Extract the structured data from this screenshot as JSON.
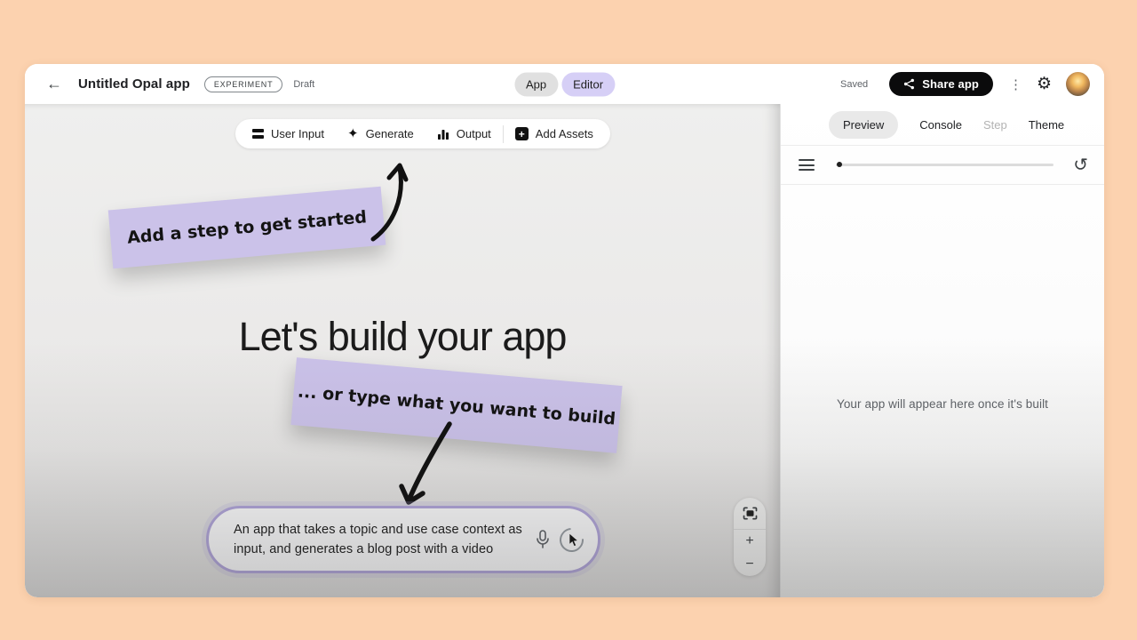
{
  "header": {
    "title": "Untitled Opal app",
    "badge": "EXPERIMENT",
    "status": "Draft",
    "mode": {
      "app": "App",
      "editor": "Editor"
    },
    "saved": "Saved",
    "share": "Share app"
  },
  "canvas": {
    "toolbar": {
      "user_input": "User Input",
      "generate": "Generate",
      "output": "Output",
      "add_assets": "Add Assets"
    },
    "sticky_top": "Add a step to get started",
    "heading": "Let's build your app",
    "sticky_bottom": "... or type what you want to build",
    "prompt": "An app that takes a topic and use case context as input, and generates a blog post with a video",
    "zoom": {
      "in": "+",
      "out": "−"
    }
  },
  "preview": {
    "tabs": [
      {
        "label": "Preview",
        "active": true
      },
      {
        "label": "Console"
      },
      {
        "label": "Step",
        "disabled": true
      },
      {
        "label": "Theme"
      }
    ],
    "message": "Your app will appear here once it's built"
  },
  "icons": {
    "back": "←",
    "more": "⋮",
    "settings": "⚙",
    "refresh": "↺",
    "sparkle": "✦",
    "plus": "+"
  },
  "colors": {
    "background_peach": "#fcd2af",
    "sticky_purple": "#cbc2e9",
    "editor_pill_purple": "#d6cff6",
    "share_button_black": "#0b0b0c",
    "prompt_border_purple": "#b3a7dc"
  }
}
